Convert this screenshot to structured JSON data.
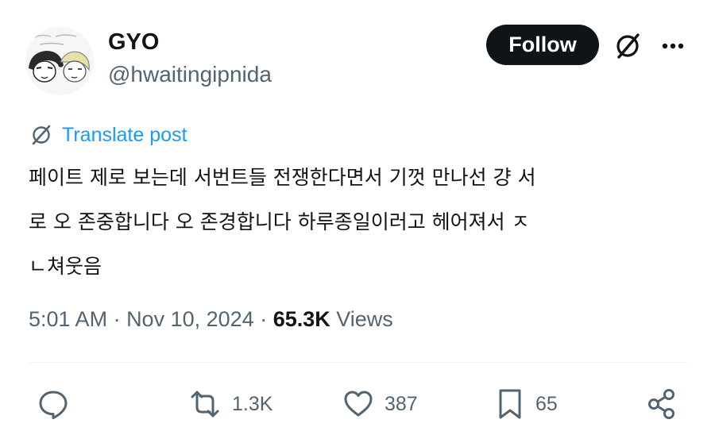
{
  "author": {
    "display_name": "GYO",
    "handle": "@hwaitingipnida",
    "avatar": "avatar-sketch-two-faces"
  },
  "header_actions": {
    "follow_label": "Follow",
    "grok_icon": "grok-icon",
    "more_icon": "more-icon"
  },
  "translate": {
    "icon": "globe-translate-icon",
    "label": "Translate post"
  },
  "tweet": {
    "lines": [
      "페이트 제로 보는데 서번트들 전쟁한다면서 기껏 만나선 걍 서",
      "로 오 존중합니다 오 존경합니다 하루종일이러고 헤어져서 ㅈ",
      "ㄴ쳐웃음"
    ]
  },
  "meta": {
    "time": "5:01 AM",
    "separator": " · ",
    "date": "Nov 10, 2024",
    "views_count": "65.3K",
    "views_label": " Views"
  },
  "actions": {
    "reply": {
      "icon": "reply-icon",
      "count": ""
    },
    "repost": {
      "icon": "repost-icon",
      "count": "1.3K"
    },
    "like": {
      "icon": "heart-icon",
      "count": "387"
    },
    "bookmark": {
      "icon": "bookmark-icon",
      "count": "65"
    },
    "share": {
      "icon": "share-icon",
      "count": ""
    }
  },
  "colors": {
    "text": "#0f1419",
    "secondary": "#536471",
    "link": "#1d9bf0",
    "follow_bg": "#0f1419",
    "divider": "#eff3f4"
  }
}
